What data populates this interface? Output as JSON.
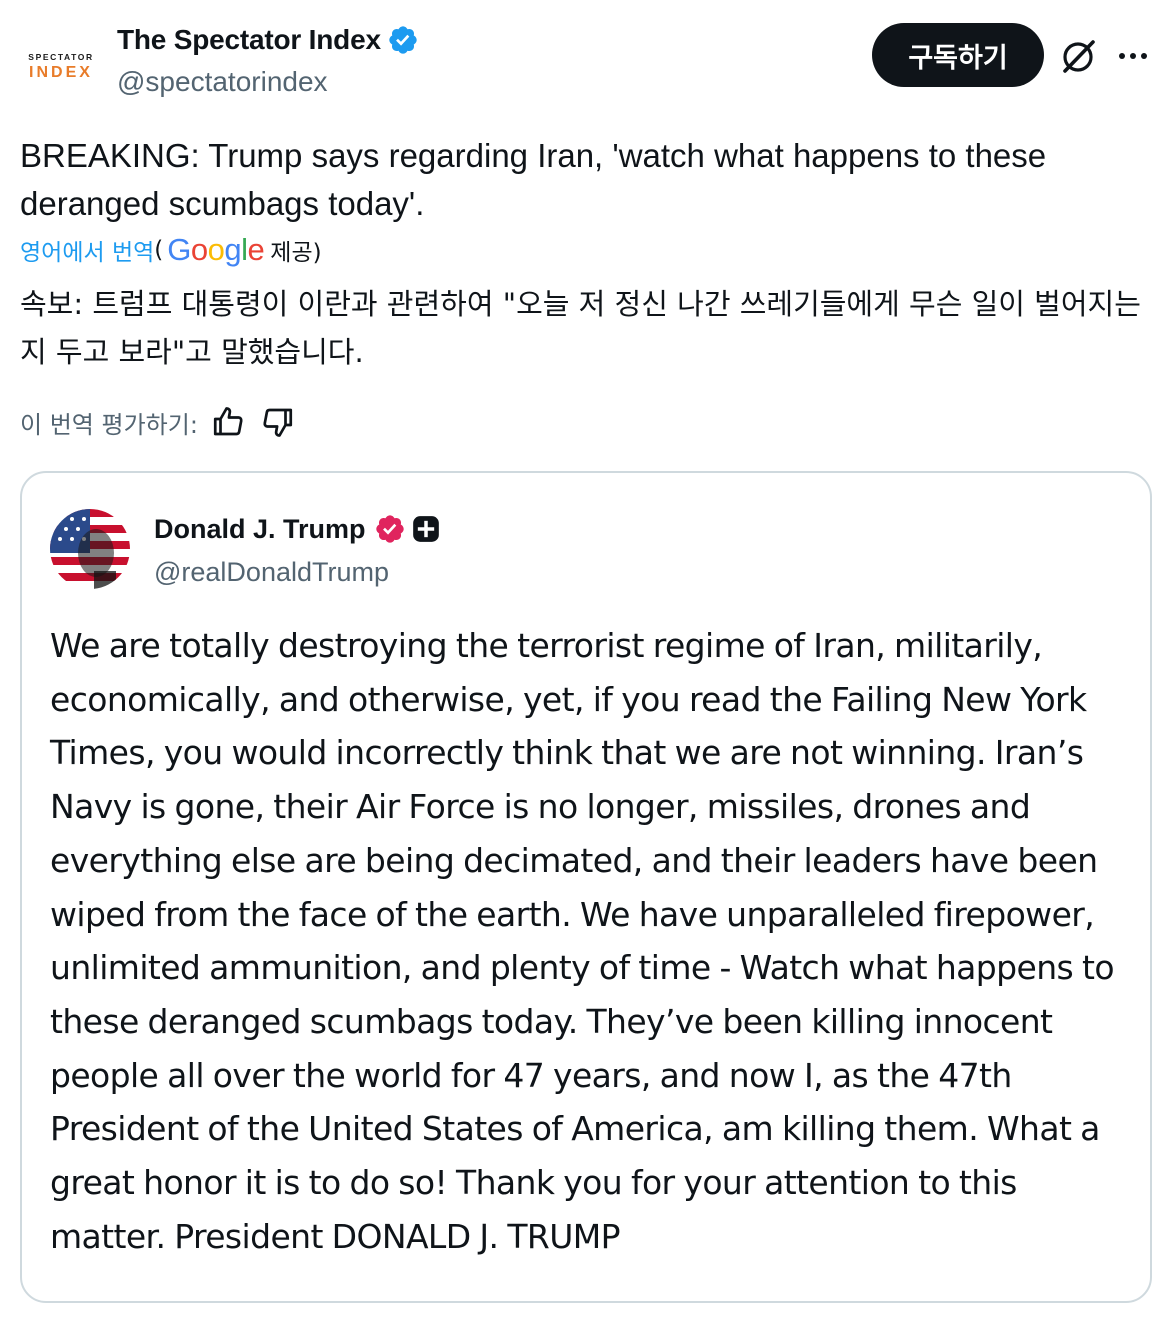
{
  "author": {
    "avatar_line1": "SPECTATOR",
    "avatar_line2": "INDEX",
    "display_name": "The Spectator Index",
    "handle": "@spectatorindex",
    "verified_icon": "blue-verified-badge-icon"
  },
  "actions": {
    "subscribe_label": "구독하기",
    "grok_icon": "grok-icon",
    "more_icon": "more-dots-icon"
  },
  "tweet": {
    "text": "BREAKING: Trump says regarding Iran, 'watch what happens to these deranged scumbags today'.",
    "translate_link": "영어에서 번역",
    "paren_open": "(",
    "provider": "Google",
    "provided_label": "제공)",
    "translated_text": "속보: 트럼프 대통령이 이란과 관련하여 \"오늘 저 정신 나간 쓰레기들에게 무슨 일이 벌어지는지 두고 보라\"고 말했습니다.",
    "rate_label": "이 번역 평가하기:"
  },
  "quote": {
    "display_name": "Donald J. Trump",
    "handle": "@realDonaldTrump",
    "text": "We are totally destroying the terrorist regime of Iran, militarily, economically, and otherwise, yet, if you read the Failing New York Times, you would incorrectly think that we are not winning. Iran’s Navy is gone, their Air Force is no longer, missiles, drones and everything else are being decimated, and their leaders have been wiped from the face of the earth. We have unparalleled firepower, unlimited ammunition, and plenty of time - Watch what happens to these deranged scumbags today. They’ve been killing innocent people all over the world for 47 years, and now I, as the 47th President of the United States of America, am killing them. What a great honor it is to do so! Thank you for your attention to this matter. President DONALD J. TRUMP"
  },
  "colors": {
    "accent_blue": "#1d9bf0",
    "text_primary": "#0f1419",
    "text_secondary": "#536471",
    "border": "#cfd9de",
    "verified_pink": "#e0245e"
  }
}
